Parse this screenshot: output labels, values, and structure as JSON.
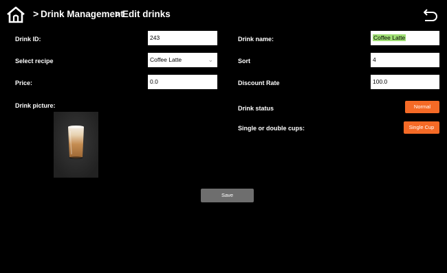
{
  "header": {
    "breadcrumb": [
      "Drink Management",
      "Edit drinks"
    ],
    "separator": ">"
  },
  "form": {
    "drink_id_label": "Drink ID:",
    "drink_id_value": "243",
    "drink_name_label": "Drink name:",
    "drink_name_value": "Coffee Latte",
    "recipe_label": "Select recipe",
    "recipe_value": "Coffee Latte",
    "sort_label": "Sort",
    "sort_value": "4",
    "price_label": "Price:",
    "price_value": "0.0",
    "discount_label": "Discount Rate",
    "discount_value": "100.0",
    "picture_label": "Drink picture:",
    "status_label": "Drink status",
    "status_button": "Normal",
    "cups_label": "Single or double cups:",
    "cups_button": "Single Cup"
  },
  "actions": {
    "save_label": "Save"
  },
  "colors": {
    "accent": "#f56a26",
    "highlight": "#9fdf74",
    "save": "#6e6e6e"
  }
}
